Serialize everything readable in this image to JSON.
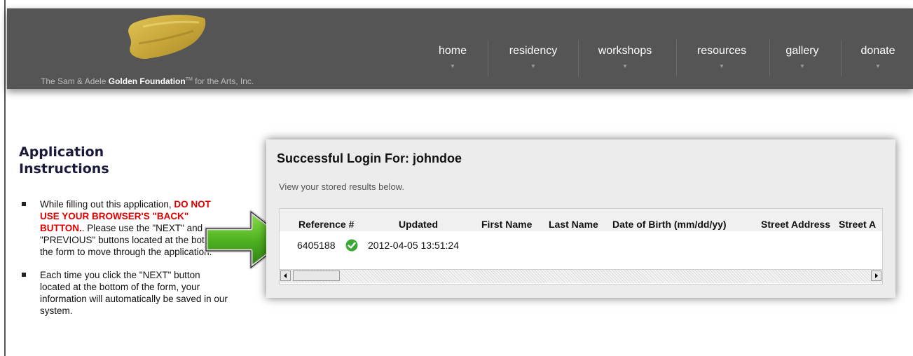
{
  "header": {
    "logo": {
      "text_pre": "The Sam & Adele ",
      "text_bold": "Golden Foundation",
      "text_tm": "TM",
      "text_post": " for the Arts, Inc.",
      "stroke_color": "#c9a73a"
    },
    "nav": [
      {
        "label": "home"
      },
      {
        "label": "residency"
      },
      {
        "label": "workshops"
      },
      {
        "label": "resources"
      },
      {
        "label": "gallery"
      },
      {
        "label": "donate"
      }
    ]
  },
  "instructions": {
    "title_line1": "Application",
    "title_line2": "Instructions",
    "item1": {
      "pre": "While filling out this application, ",
      "warning": "DO NOT USE YOUR BROWSER'S \"BACK\" BUTTON.",
      "post": ". Please use the \"NEXT\" and \"PREVIOUS\" buttons located at the bottom of the form to move through the application."
    },
    "item2": {
      "text": "Each time you click the \"NEXT\" button located at the bottom of the form, your information will automatically be saved in our system."
    }
  },
  "login": {
    "title": "Successful Login For: johndoe",
    "subtitle": "View your stored results below.",
    "columns": [
      "Reference #",
      "Updated",
      "First Name",
      "Last Name",
      "Date of Birth (mm/dd/yy)",
      "Street Address",
      "Street A"
    ],
    "row": {
      "reference": "6405188",
      "status_icon": "check-circle-icon",
      "updated": "2012-04-05 13:51:24"
    }
  },
  "colors": {
    "header_bg": "#555555",
    "warning_red": "#e00000",
    "check_green": "#3aa832",
    "arrow_green": "#4caf1f"
  }
}
